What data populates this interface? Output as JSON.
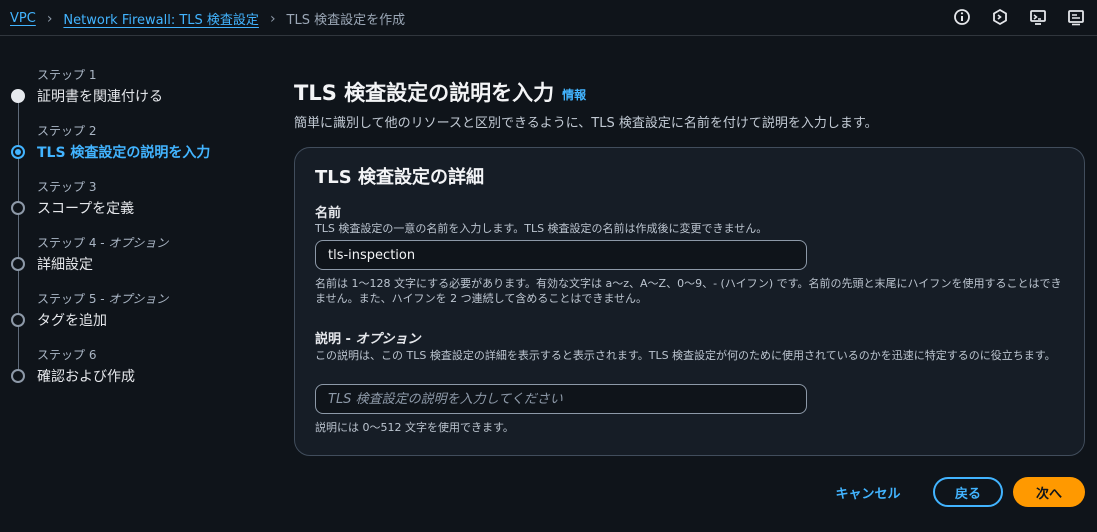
{
  "breadcrumb": {
    "items": [
      "VPC",
      "Network Firewall: TLS 検査設定"
    ],
    "current": "TLS 検査設定を作成"
  },
  "top_icons": [
    "info-icon",
    "cloudshell-icon",
    "notifications-icon",
    "settings-icon"
  ],
  "steps": [
    {
      "number": "ステップ 1",
      "optional": "",
      "label": "証明書を関連付ける",
      "state": "done"
    },
    {
      "number": "ステップ 2",
      "optional": "",
      "label": "TLS 検査設定の説明を入力",
      "state": "current"
    },
    {
      "number": "ステップ 3",
      "optional": "",
      "label": "スコープを定義",
      "state": "todo"
    },
    {
      "number": "ステップ 4 - ",
      "optional": "オプション",
      "label": "詳細設定",
      "state": "todo"
    },
    {
      "number": "ステップ 5 - ",
      "optional": "オプション",
      "label": "タグを追加",
      "state": "todo"
    },
    {
      "number": "ステップ 6",
      "optional": "",
      "label": "確認および作成",
      "state": "todo"
    }
  ],
  "header": {
    "title": "TLS 検査設定の説明を入力",
    "info": "情報",
    "description": "簡単に識別して他のリソースと区別できるように、TLS 検査設定に名前を付けて説明を入力します。"
  },
  "panel": {
    "title": "TLS 検査設定の詳細",
    "name_field": {
      "label": "名前",
      "description": "TLS 検査設定の一意の名前を入力します。TLS 検査設定の名前は作成後に変更できません。",
      "value": "tls-inspection",
      "constraint": "名前は 1〜128 文字にする必要があります。有効な文字は a〜z、A〜Z、0〜9、- (ハイフン) です。名前の先頭と末尾にハイフンを使用することはできません。また、ハイフンを 2 つ連続して含めることはできません。"
    },
    "description_field": {
      "label": "説明 - ",
      "label_optional": "オプション",
      "description": "この説明は、この TLS 検査設定の詳細を表示すると表示されます。TLS 検査設定が何のために使用されているのかを迅速に特定するのに役立ちます。",
      "placeholder": "TLS 検査設定の説明を入力してください",
      "value": "",
      "constraint": "説明には 0〜512 文字を使用できます。"
    }
  },
  "footer": {
    "cancel": "キャンセル",
    "back": "戻る",
    "next": "次へ"
  },
  "colors": {
    "accent": "#42b4ff",
    "primary_button": "#ff9900",
    "background": "#0f141a",
    "panel": "#161d26"
  }
}
